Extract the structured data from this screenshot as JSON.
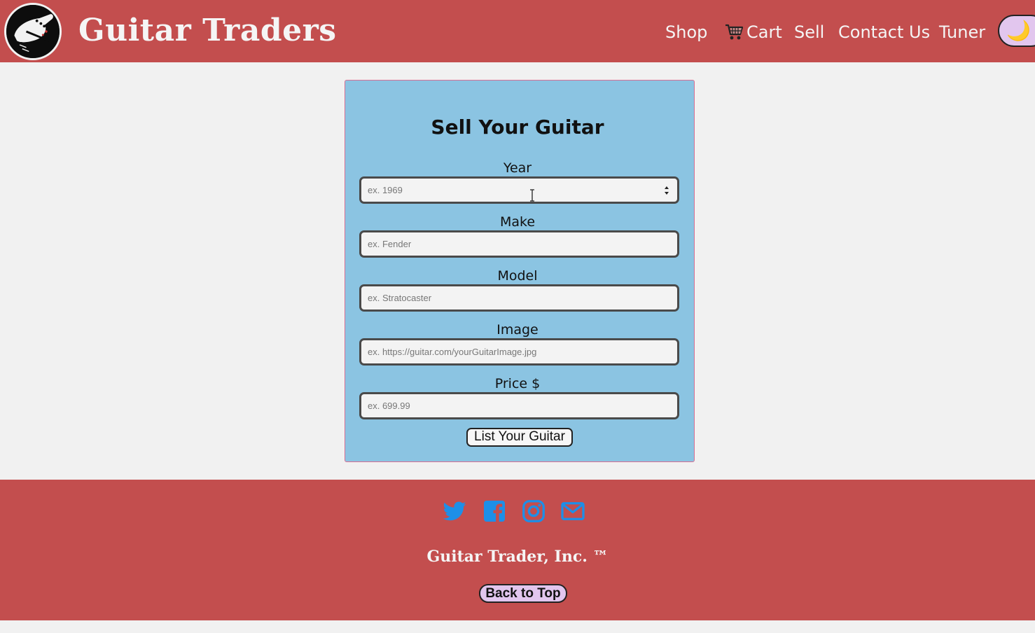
{
  "header": {
    "brand": "Guitar Traders",
    "logo_icon": "guitar-headstock-icon",
    "nav": {
      "shop": "Shop",
      "cart": "Cart",
      "sell": "Sell",
      "contact": "Contact Us",
      "tuner": "Tuner"
    },
    "cart_icon": "shopping-cart-icon",
    "theme_toggle_icon": "moon-icon"
  },
  "form": {
    "title": "Sell Your Guitar",
    "fields": [
      {
        "label": "Year",
        "value": "",
        "placeholder": "ex. 1969",
        "type": "number"
      },
      {
        "label": "Make",
        "value": "",
        "placeholder": "ex. Fender",
        "type": "text"
      },
      {
        "label": "Model",
        "value": "",
        "placeholder": "ex. Stratocaster",
        "type": "text"
      },
      {
        "label": "Image",
        "value": "",
        "placeholder": "ex. https://guitar.com/yourGuitarImage.jpg",
        "type": "text"
      },
      {
        "label": "Price $",
        "value": "",
        "placeholder": "ex. 699.99",
        "type": "text"
      }
    ],
    "submit_label": "List Your Guitar"
  },
  "footer": {
    "social_icons": [
      "twitter-icon",
      "facebook-icon",
      "instagram-icon",
      "email-icon"
    ],
    "copyright": "Guitar Trader, Inc. ™",
    "back_to_top": "Back to Top"
  },
  "colors": {
    "header_bg": "#c34e4e",
    "page_bg": "#f1f1f1",
    "card_bg": "#8bc4e2",
    "social_blue": "#1d8fe8",
    "toggle_bg": "#e2c6ee"
  }
}
